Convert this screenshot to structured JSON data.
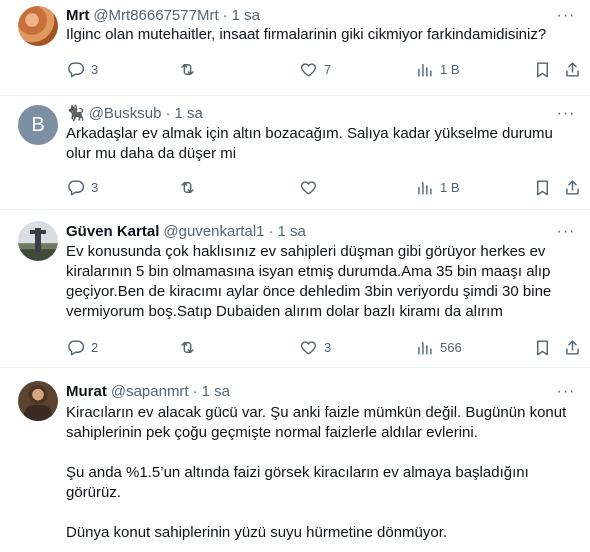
{
  "tweets": [
    {
      "name": "Mrt",
      "handle": "@Mrt86667577Mrt",
      "time": "1 sa",
      "text": "Ilginc olan mutehaitler, insaat firmalarinin giki cikmiyor farkindamidisiniz?",
      "replies": "3",
      "retweets": "",
      "likes": "7",
      "views": "1 B"
    },
    {
      "name": "",
      "handle": "@Busksub",
      "time": "1 sa",
      "avatar_letter": "B",
      "name_emoji": "🐈‍⬛",
      "text": "Arkadaşlar ev almak için altın bozacağım. Salıya kadar yükselme durumu\nolur mu daha da düşer mi",
      "replies": "3",
      "retweets": "",
      "likes": "",
      "views": "1 B"
    },
    {
      "name": "Güven Kartal",
      "handle": "@guvenkartal1",
      "time": "1 sa",
      "text": "Ev konusunda çok haklısınız ev sahipleri düşman gibi görüyor herkes ev\nkiralarının 5 bin olmamasına isyan etmiş durumda.Ama 35 bin maaşı alıp\ngeçiyor.Ben de kiracımı aylar önce dehledim 3bin veriyordu şimdi 30 bine\nvermiyorum boş.Satıp Dubaiden alırım dolar bazlı kiramı da alırım",
      "replies": "2",
      "retweets": "",
      "likes": "3",
      "views": "566"
    },
    {
      "name": "Murat",
      "handle": "@sapanmrt",
      "time": "1 sa",
      "text": "Kiracıların ev alacak gücü var. Şu anki faizle mümkün değil. Bugünün konut\nsahiplerinin pek çoğu geçmişte normal faizlerle aldılar evlerini.\n\nŞu anda %1.5’un altında faizi görsek kiracıların ev almaya başladığını\ngörürüz.\n\nDünya konut sahiplerinin yüzü suyu hürmetine dönmüyor."
    }
  ],
  "icons": {
    "reply": "reply-icon",
    "retweet": "retweet-icon",
    "like": "heart-icon",
    "views": "views-chart-icon",
    "bookmark": "bookmark-icon",
    "share": "share-icon",
    "more": "more-dots-icon"
  },
  "colors": {
    "text": "#0f1419",
    "secondary": "#536471",
    "divider": "#eff3f4",
    "default_avatar": "#7d90a3"
  }
}
